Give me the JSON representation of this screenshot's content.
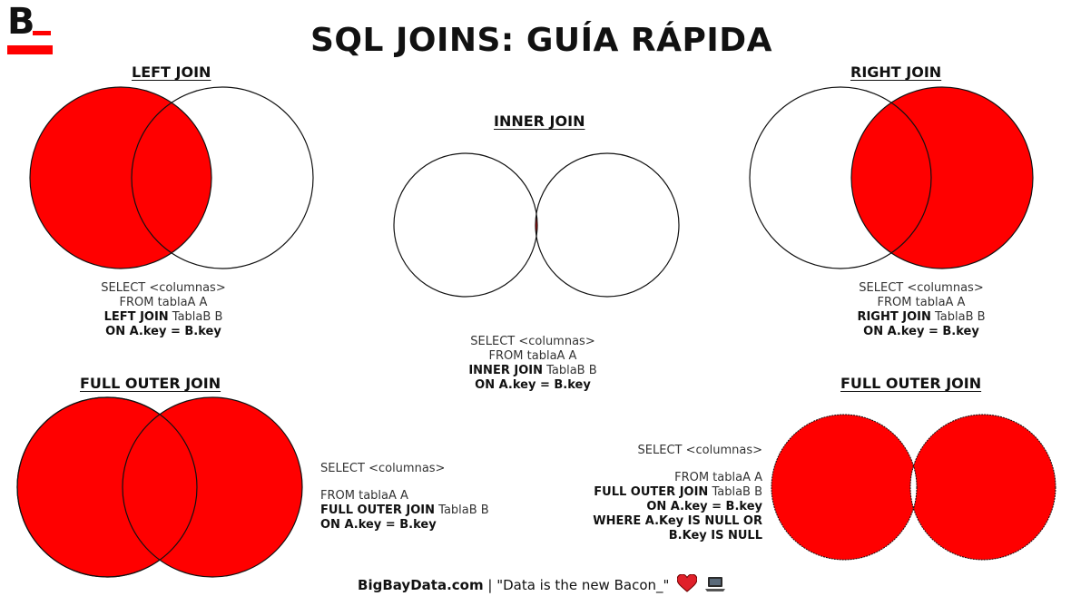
{
  "logo": {
    "letter": "B"
  },
  "title": "SQL JOINS: GUÍA RÁPIDA",
  "colors": {
    "accent": "#ff0000",
    "stroke": "#111111"
  },
  "diagrams": [
    {
      "id": "left-join",
      "title": "LEFT JOIN",
      "code": {
        "l1": "SELECT <columnas>",
        "l2": "FROM tablaA A",
        "l3_kw": "LEFT JOIN",
        "l3_rest": " TablaB B",
        "l4": "ON A.key = B.key"
      }
    },
    {
      "id": "inner-join",
      "title": "INNER JOIN",
      "code": {
        "l1": "SELECT <columnas>",
        "l2": "FROM tablaA A",
        "l3_kw": "INNER JOIN",
        "l3_rest": " TablaB B",
        "l4": "ON A.key = B.key"
      }
    },
    {
      "id": "right-join",
      "title": "RIGHT JOIN",
      "code": {
        "l1": "SELECT <columnas>",
        "l2": "FROM tablaA A",
        "l3_kw": "RIGHT JOIN",
        "l3_rest": " TablaB B",
        "l4": "ON A.key = B.key"
      }
    },
    {
      "id": "full-outer-join",
      "title": "FULL OUTER JOIN",
      "code": {
        "l1": "SELECT <columnas>",
        "l2": "FROM tablaA A",
        "l3_kw": "FULL OUTER JOIN",
        "l3_rest": " TablaB B",
        "l4": "ON A.key = B.key"
      }
    },
    {
      "id": "full-outer-join-exclusive",
      "title": "FULL OUTER JOIN",
      "code": {
        "l1": "SELECT <columnas>",
        "l2": "FROM tablaA A",
        "l3_kw": "FULL OUTER JOIN",
        "l3_rest": " TablaB B",
        "l4": "ON A.key = B.key",
        "l5": "WHERE A.Key IS NULL OR",
        "l6": "B.Key IS NULL"
      }
    }
  ],
  "footer": {
    "site": "BigBayData.com",
    "separator": " | ",
    "tagline": "\"Data is the new Bacon_\"",
    "heart_icon": "heart-icon",
    "laptop_icon": "laptop-icon"
  }
}
